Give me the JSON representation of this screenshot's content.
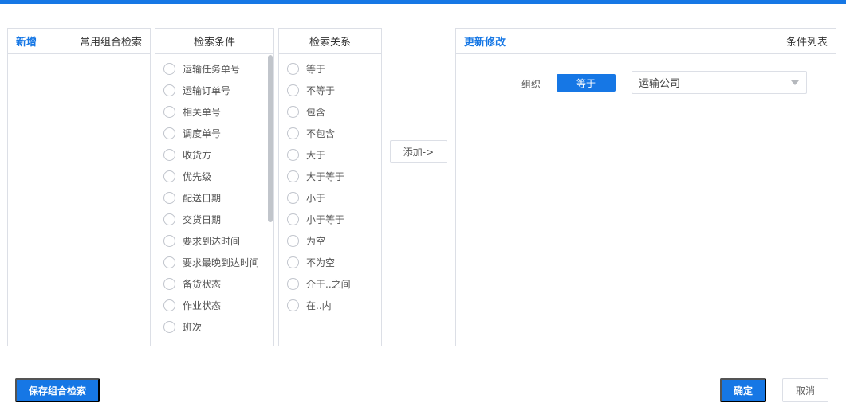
{
  "common_panel": {
    "add_label": "新增",
    "title": "常用组合检索"
  },
  "conditions_panel": {
    "title": "检索条件",
    "items": [
      "运输任务单号",
      "运输订单号",
      "相关单号",
      "调度单号",
      "收货方",
      "优先级",
      "配送日期",
      "交货日期",
      "要求到达时间",
      "要求最晚到达时间",
      "备货状态",
      "作业状态",
      "班次"
    ]
  },
  "relations_panel": {
    "title": "检索关系",
    "items": [
      "等于",
      "不等于",
      "包含",
      "不包含",
      "大于",
      "大于等于",
      "小于",
      "小于等于",
      "为空",
      "不为空",
      "介于..之间",
      "在..内"
    ]
  },
  "add_button": "添加->",
  "condition_list_panel": {
    "update_label": "更新修改",
    "title": "条件列表",
    "rows": [
      {
        "field": "组织",
        "operator": "等于",
        "value": "运输公司"
      }
    ]
  },
  "footer": {
    "save_label": "保存组合检索",
    "ok_label": "确定",
    "cancel_label": "取消"
  },
  "colors": {
    "accent": "#1677e5",
    "border": "#dcdfe6"
  }
}
